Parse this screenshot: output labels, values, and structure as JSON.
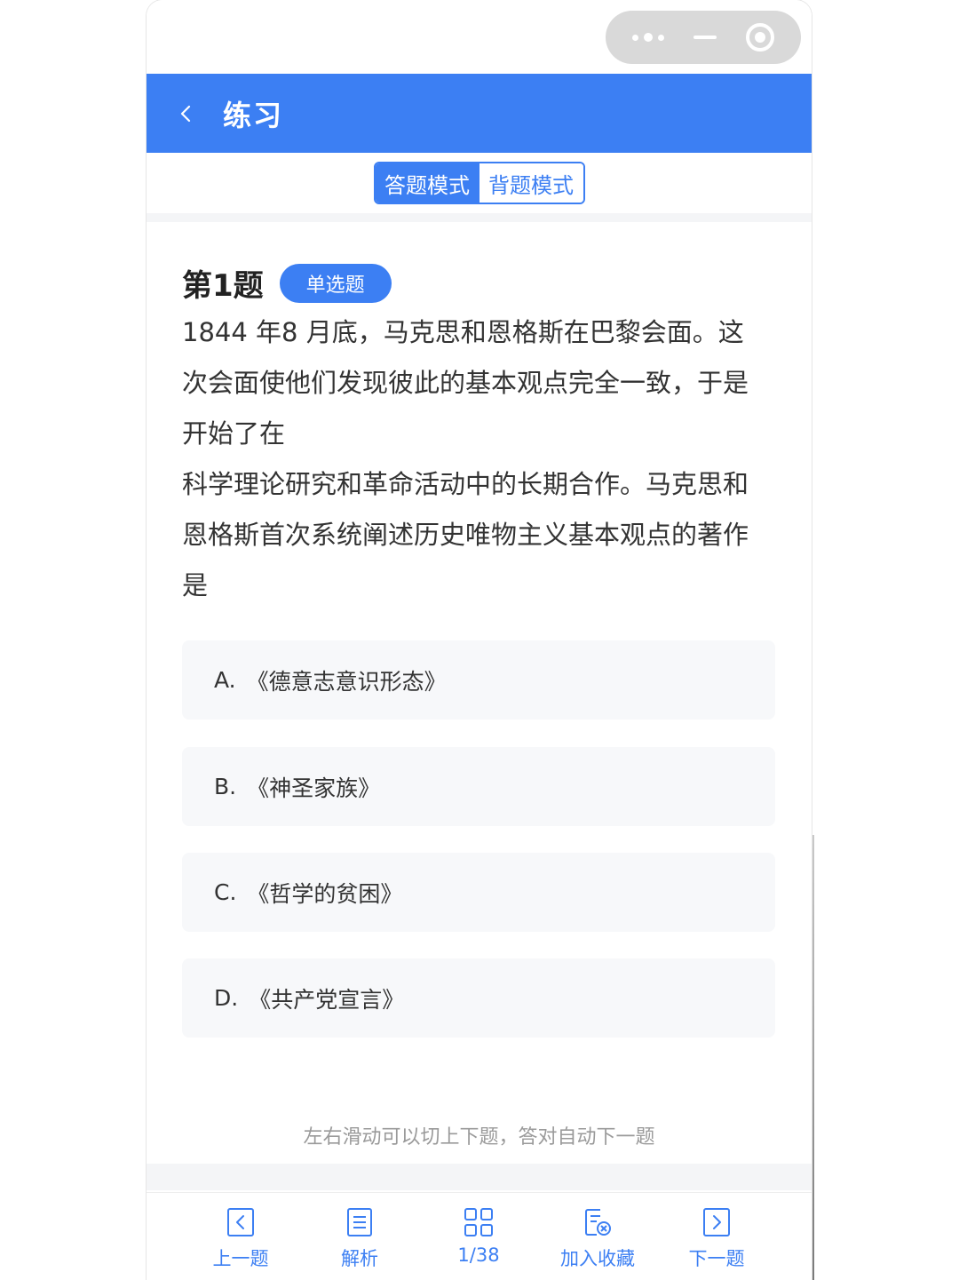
{
  "colors": {
    "accent": "#3c7ff3",
    "option_bg": "#f7f8fa",
    "hint_text": "#9a9a9a"
  },
  "capsule": {
    "more_icon": "more-dots-icon",
    "minimize_icon": "minimize-icon",
    "close_icon": "target-close-icon"
  },
  "header": {
    "back_icon": "chevron-left-icon",
    "title": "练习"
  },
  "mode": {
    "answer_mode": "答题模式",
    "memorize_mode": "背题模式",
    "selected": "答题模式"
  },
  "question": {
    "number_label": "第1题",
    "type_badge": "单选题",
    "lines": [
      "1844 年8 月底，马克思和恩格斯在巴黎会面。这",
      "次会面使他们发现彼此的基本观点完全一致，于是",
      "开始了在",
      "科学理论研究和革命活动中的长期合作。马克思和",
      "恩格斯首次系统阐述历史唯物主义基本观点的著作",
      "是"
    ],
    "options": [
      {
        "letter": "A.",
        "text": "《德意志意识形态》"
      },
      {
        "letter": "B.",
        "text": "《神圣家族》"
      },
      {
        "letter": "C.",
        "text": "《哲学的贫困》"
      },
      {
        "letter": "D.",
        "text": "《共产党宣言》"
      }
    ]
  },
  "hint": "左右滑动可以切上下题，答对自动下一题",
  "tabbar": [
    {
      "label": "上一题",
      "icon": "prev-icon"
    },
    {
      "label": "解析",
      "icon": "analysis-icon"
    },
    {
      "label": "1/38",
      "icon": "grid-icon"
    },
    {
      "label": "加入收藏",
      "icon": "favorite-icon"
    },
    {
      "label": "下一题",
      "icon": "next-icon"
    }
  ]
}
